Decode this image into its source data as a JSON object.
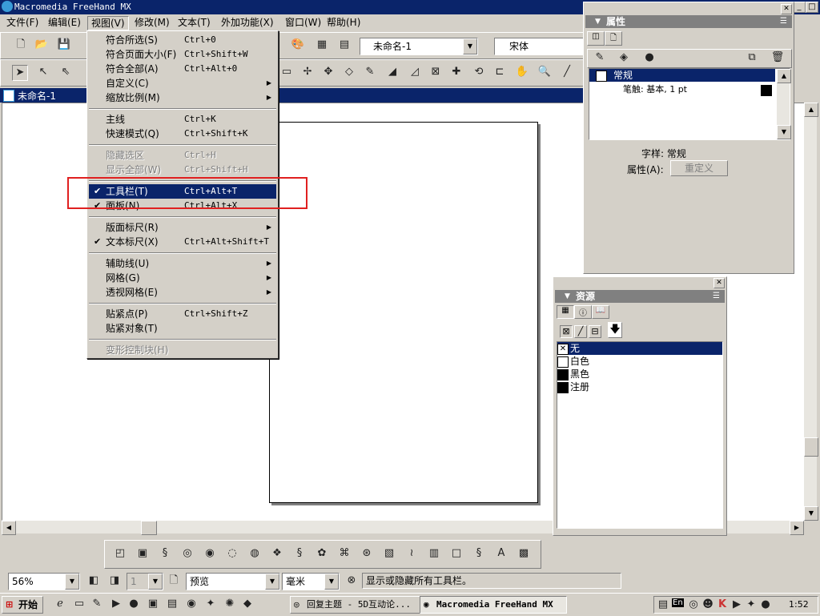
{
  "window": {
    "title": "Macromedia FreeHand MX"
  },
  "menubar": [
    "文件(F)",
    "编辑(E)",
    "视图(V)",
    "修改(M)",
    "文本(T)",
    "外加功能(X)",
    "窗口(W)",
    "帮助(H)"
  ],
  "view_menu": [
    {
      "label": "符合所选(S)",
      "shortcut": "Ctrl+0"
    },
    {
      "label": "符合页面大小(F)",
      "shortcut": "Ctrl+Shift+W"
    },
    {
      "label": "符合全部(A)",
      "shortcut": "Ctrl+Alt+0"
    },
    {
      "label": "自定义(C)",
      "shortcut": ""
    },
    {
      "label": "缩放比例(M)",
      "shortcut": ""
    },
    {
      "label": "主线",
      "shortcut": "Ctrl+K"
    },
    {
      "label": "快速模式(Q)",
      "shortcut": "Ctrl+Shift+K"
    },
    {
      "label": "隐藏选区",
      "shortcut": "Ctrl+H"
    },
    {
      "label": "显示全部(W)",
      "shortcut": "Ctrl+Shift+H"
    },
    {
      "label": "工具栏(T)",
      "shortcut": "Ctrl+Alt+T"
    },
    {
      "label": "面板(N)",
      "shortcut": "Ctrl+Alt+X"
    },
    {
      "label": "版面标尺(R)",
      "shortcut": ""
    },
    {
      "label": "文本标尺(X)",
      "shortcut": "Ctrl+Alt+Shift+T"
    },
    {
      "label": "辅助线(U)",
      "shortcut": ""
    },
    {
      "label": "网格(G)",
      "shortcut": ""
    },
    {
      "label": "透视网格(E)",
      "shortcut": ""
    },
    {
      "label": "贴紧点(P)",
      "shortcut": "Ctrl+Shift+Z"
    },
    {
      "label": "贴紧对象(T)",
      "shortcut": ""
    },
    {
      "label": "变形控制块(H)",
      "shortcut": ""
    }
  ],
  "toolbar": {
    "document_select": "未命名-1",
    "font_select": "宋体"
  },
  "document": {
    "title": "未命名-1"
  },
  "properties_panel": {
    "title": "属性",
    "item": "常规",
    "stroke": "笔触: 基本, 1 pt",
    "style_label": "字样: 常规",
    "attr_label": "属性(A):",
    "redefine_button": "重定义"
  },
  "assets_panel": {
    "title": "资源",
    "colors": [
      "无",
      "白色",
      "黑色",
      "注册"
    ],
    "colors_hex": [
      "#ffffff",
      "#ffffff",
      "#000000",
      "#000000"
    ]
  },
  "status": {
    "zoom": "56%",
    "page_number": "1",
    "preview": "预览",
    "units": "毫米",
    "message": "显示或隐藏所有工具栏。"
  },
  "taskbar": {
    "start": "开始",
    "task1": "回复主题 - 5D互动论...",
    "task2": "Macromedia FreeHand MX",
    "lang": "En",
    "clock": "1:52"
  },
  "colors": {
    "titlebar": "#0a246a",
    "face": "#d4d0c8",
    "highlight_box": "#e02020"
  }
}
